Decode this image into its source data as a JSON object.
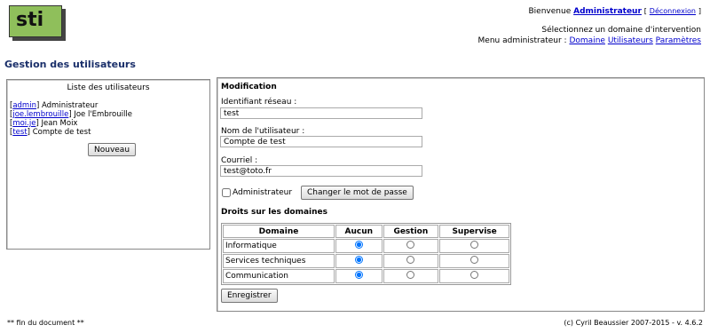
{
  "logo": {
    "text": "sti",
    "color": "#8fbf5b"
  },
  "header": {
    "welcome": "Bienvenue",
    "user": "Administrateur",
    "logout_open": "[",
    "logout": "Déconnexion",
    "logout_close": "]",
    "select_domain": "Sélectionnez un domaine d'intervention",
    "admin_menu_label": "Menu administrateur :",
    "menu": [
      "Domaine",
      "Utilisateurs",
      "Paramètres"
    ]
  },
  "page_title": "Gestion des utilisateurs",
  "users_panel": {
    "title": "Liste des utilisateurs",
    "users": [
      {
        "login": "admin",
        "name": "Administrateur"
      },
      {
        "login": "joe.lembrouille",
        "name": "Joe l'Embrouille"
      },
      {
        "login": "moi.je",
        "name": "Jean Moix"
      },
      {
        "login": "test",
        "name": "Compte de test"
      }
    ],
    "new_button": "Nouveau"
  },
  "edit_panel": {
    "title": "Modification",
    "login_label": "Identifiant réseau :",
    "login_value": "test",
    "name_label": "Nom de l'utilisateur :",
    "name_value": "Compte de test",
    "email_label": "Courriel :",
    "email_value": "test@toto.fr",
    "admin_label": "Administrateur",
    "admin_checked": false,
    "change_password_button": "Changer le mot de passe",
    "rights_title": "Droits sur les domaines",
    "rights_headers": [
      "Domaine",
      "Aucun",
      "Gestion",
      "Supervise"
    ],
    "rights": [
      {
        "domain": "Informatique",
        "selected": "Aucun"
      },
      {
        "domain": "Services techniques",
        "selected": "Aucun"
      },
      {
        "domain": "Communication",
        "selected": "Aucun"
      }
    ],
    "save_button": "Enregistrer"
  },
  "footer": {
    "left": "** fin du document **",
    "right": "(c) Cyril Beaussier 2007-2015 - v. 4.6.2"
  }
}
